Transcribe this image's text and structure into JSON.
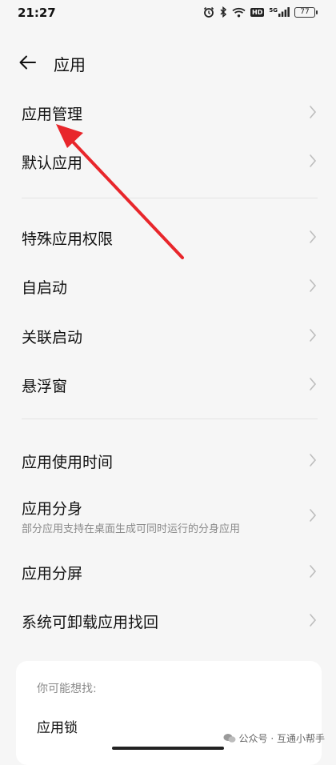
{
  "status_bar": {
    "time": "21:27",
    "battery": "77",
    "network_label": "HD",
    "signal_label": "5G"
  },
  "header": {
    "title": "应用",
    "back_icon": "arrow-left-icon"
  },
  "sections": [
    {
      "items": [
        {
          "label": "应用管理"
        },
        {
          "label": "默认应用"
        }
      ]
    },
    {
      "items": [
        {
          "label": "特殊应用权限"
        },
        {
          "label": "自启动"
        },
        {
          "label": "关联启动"
        },
        {
          "label": "悬浮窗"
        }
      ]
    },
    {
      "items": [
        {
          "label": "应用使用时间"
        },
        {
          "label": "应用分身",
          "subtitle": "部分应用支持在桌面生成可同时运行的分身应用"
        },
        {
          "label": "应用分屏"
        },
        {
          "label": "系统可卸载应用找回"
        }
      ]
    }
  ],
  "suggest": {
    "title": "你可能想找:",
    "items": [
      "应用锁"
    ]
  },
  "watermark": {
    "text": "公众号 · 互通小帮手"
  },
  "annotation": {
    "color": "#e8262b",
    "target": "应用管理"
  }
}
